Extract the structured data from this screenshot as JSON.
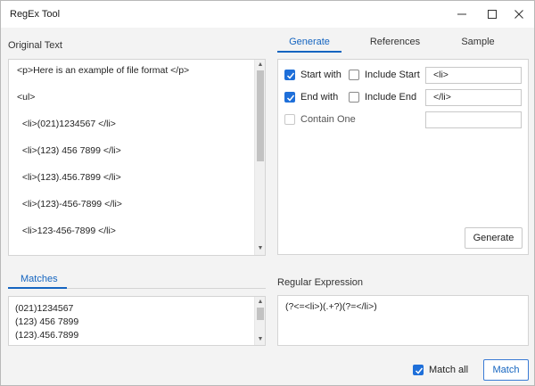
{
  "window": {
    "title": "RegEx Tool"
  },
  "original_text": {
    "label": "Original Text",
    "lines": [
      "<p>Here is an example of file format </p>",
      "<ul>",
      "  <li>(021)1234567 </li>",
      "  <li>(123) 456 7899 </li>",
      "  <li>(123).456.7899 </li>",
      "  <li>(123)-456-7899 </li>",
      "  <li>123-456-7899 </li>"
    ]
  },
  "tabs": [
    {
      "label": "Generate",
      "active": true
    },
    {
      "label": "References",
      "active": false
    },
    {
      "label": "Sample",
      "active": false
    }
  ],
  "generate": {
    "start_with_label": "Start with",
    "start_with_checked": true,
    "include_start_label": "Include Start",
    "include_start_checked": false,
    "start_value": "<li>",
    "end_with_label": "End with",
    "end_with_checked": true,
    "include_end_label": "Include End",
    "include_end_checked": false,
    "end_value": "</li>",
    "contain_one_label": "Contain One",
    "contain_one_checked": false,
    "contain_value": "",
    "generate_button": "Generate"
  },
  "matches": {
    "tab_label": "Matches",
    "items": [
      "(021)1234567",
      "(123) 456 7899",
      "(123).456.7899"
    ]
  },
  "regular_expression": {
    "label": "Regular Expression",
    "value": "(?<=<li>)(.+?)(?=</li>)"
  },
  "footer": {
    "match_all_label": "Match all",
    "match_all_checked": true,
    "match_button": "Match"
  },
  "colors": {
    "accent": "#1565c0",
    "checkbox": "#1e6fd9"
  }
}
